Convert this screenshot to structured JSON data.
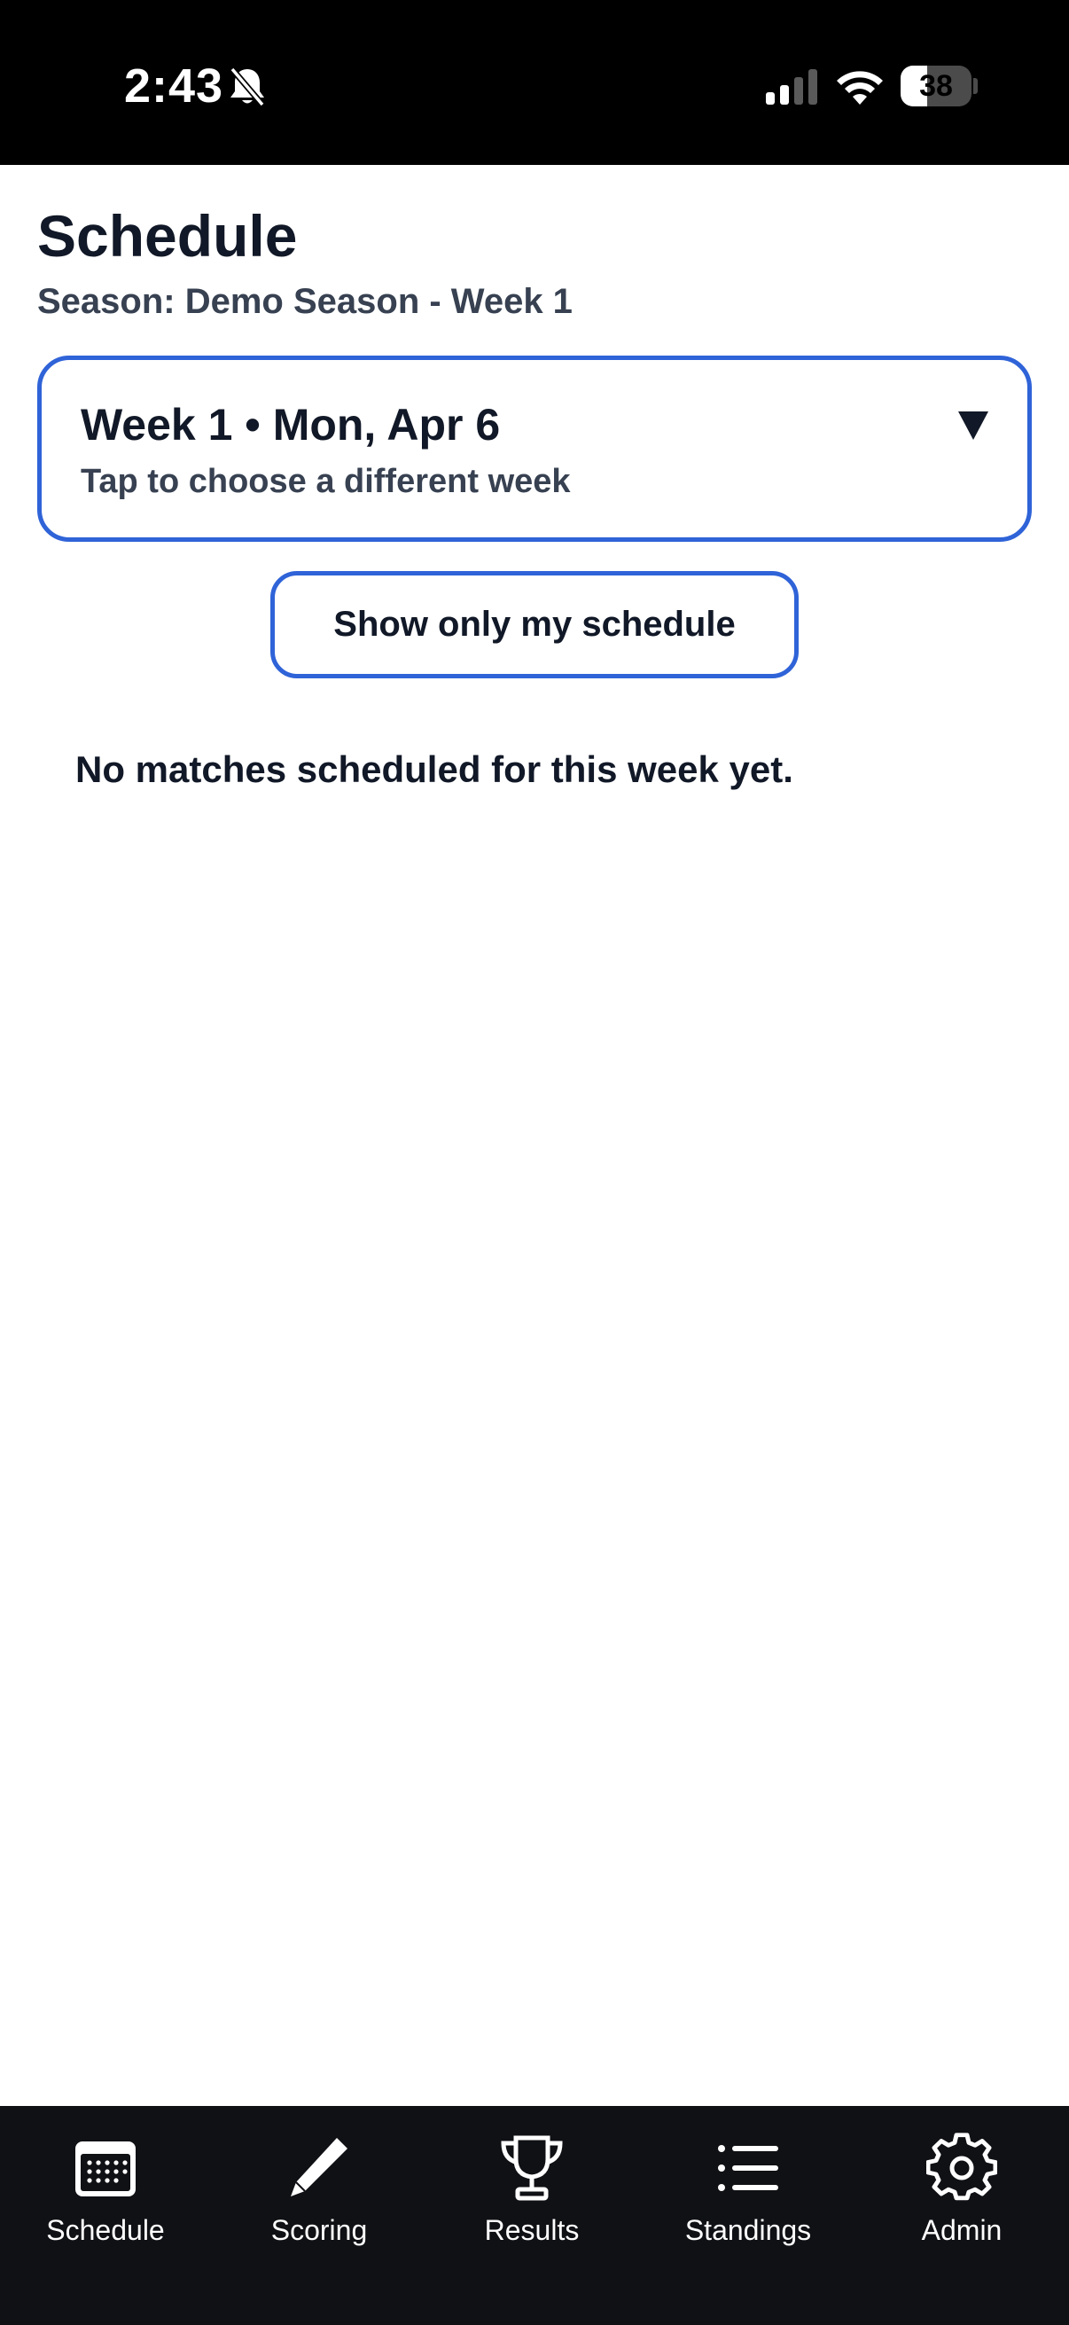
{
  "status_bar": {
    "time": "2:43",
    "battery": "38",
    "battery_level": 0.38
  },
  "header": {
    "title": "Schedule",
    "season": "Season: Demo Season - Week 1"
  },
  "week_selector": {
    "title": "Week 1 • Mon, Apr 6",
    "hint": "Tap to choose a different week"
  },
  "filter_button": {
    "label": "Show only my schedule"
  },
  "empty_state": {
    "message": "No matches scheduled for this week yet."
  },
  "tabs": [
    {
      "label": "Schedule",
      "icon": "calendar-icon",
      "active": true
    },
    {
      "label": "Scoring",
      "icon": "pencil-icon",
      "active": false
    },
    {
      "label": "Results",
      "icon": "trophy-icon",
      "active": false
    },
    {
      "label": "Standings",
      "icon": "list-icon",
      "active": false
    },
    {
      "label": "Admin",
      "icon": "gear-icon",
      "active": false
    }
  ],
  "colors": {
    "accent": "#2f63d8",
    "tab_bar_bg": "#101115",
    "text": "#111827"
  }
}
